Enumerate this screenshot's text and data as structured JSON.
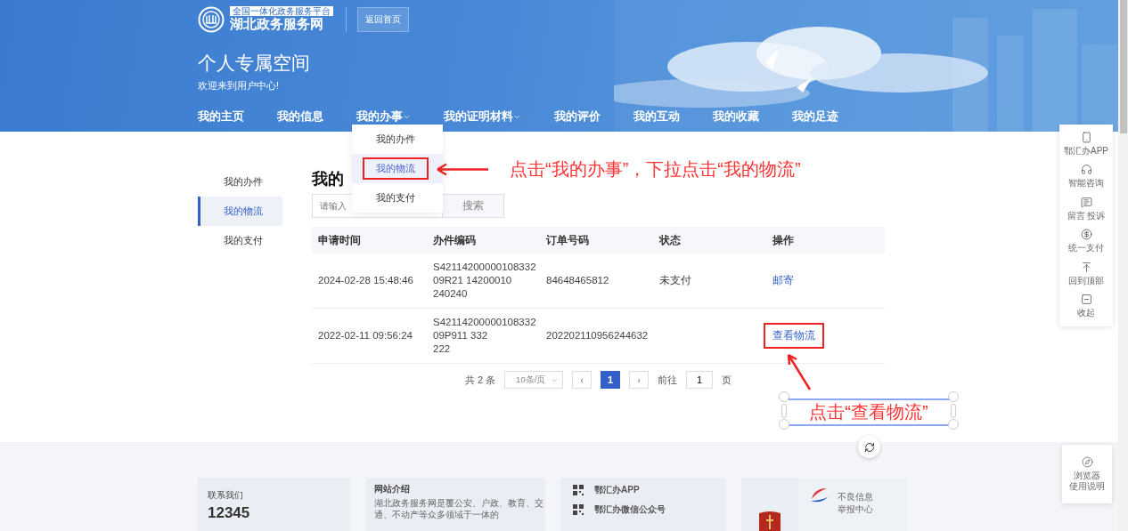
{
  "header": {
    "platform_tag": "全国一体化政务服务平台",
    "site_name": "湖北政务服务网",
    "home_button": "返回首页",
    "title": "个人专属空间",
    "welcome": "欢迎来到用户中心!"
  },
  "nav": [
    {
      "label": "我的主页",
      "dropdown": false,
      "expanded": false
    },
    {
      "label": "我的信息",
      "dropdown": false,
      "expanded": false
    },
    {
      "label": "我的办事",
      "dropdown": true,
      "expanded": true
    },
    {
      "label": "我的证明材料",
      "dropdown": true,
      "expanded": false
    },
    {
      "label": "我的评价",
      "dropdown": false,
      "expanded": false
    },
    {
      "label": "我的互动",
      "dropdown": false,
      "expanded": false
    },
    {
      "label": "我的收藏",
      "dropdown": false,
      "expanded": false
    },
    {
      "label": "我的足迹",
      "dropdown": false,
      "expanded": false
    }
  ],
  "dropdown_menu": [
    {
      "label": "我的办件",
      "selected": false
    },
    {
      "label": "我的物流",
      "selected": true
    },
    {
      "label": "我的支付",
      "selected": false
    }
  ],
  "sidebar": [
    {
      "label": "我的办件",
      "selected": false
    },
    {
      "label": "我的物流",
      "selected": true
    },
    {
      "label": "我的支付",
      "selected": false
    }
  ],
  "page_title": "我的",
  "search": {
    "placeholder": "请输入",
    "button": "搜索"
  },
  "table": {
    "columns": [
      "申请时间",
      "办件编码",
      "订单号码",
      "状态",
      "操作"
    ],
    "rows": [
      {
        "time": "2024-02-28 15:48:46",
        "code": [
          "S42114200000108332",
          "09R21 14200010",
          "240240"
        ],
        "order": "84648465812",
        "status": "未支付",
        "action": "邮寄",
        "annotated": false
      },
      {
        "time": "2022-02-11 09:56:24",
        "code": [
          "S42114200000108332",
          "09P911 332",
          "222"
        ],
        "order": "202202110956244632",
        "status": "",
        "action": "查看物流",
        "annotated": true
      }
    ]
  },
  "pagination": {
    "total": "共 2 条",
    "page_size": "10条/页",
    "prev": "‹",
    "pages": [
      {
        "label": "1",
        "selected": true
      }
    ],
    "next": "›",
    "goto_label": "前往",
    "goto_value": "1",
    "page_suffix": "页"
  },
  "annotations": {
    "menu_hint": "点击“我的办事”，下拉点击“我的物流”",
    "action_hint": "点击“查看物流”"
  },
  "side_tools": [
    {
      "label": "鄂汇办APP",
      "kind": "phone"
    },
    {
      "label": "智能咨询",
      "kind": "headset"
    },
    {
      "label": "留言 投诉",
      "kind": "chat"
    },
    {
      "label": "统一支付",
      "kind": "yen"
    },
    {
      "label": "回到顶部",
      "kind": "top"
    },
    {
      "label": "收起",
      "kind": "collapse"
    }
  ],
  "browser_help": [
    "浏览器",
    "使用说明"
  ],
  "footer": {
    "contact": {
      "label": "联系我们",
      "phone": "12345"
    },
    "intro": {
      "title": "网站介绍",
      "text": "湖北政务服务网是覆公安、户政、教育、交通、不动产等众多领域于一体的"
    },
    "apps": [
      {
        "label": "鄂汇办APP"
      },
      {
        "label": "鄂汇办微信公众号"
      }
    ],
    "report": {
      "label": "不良信息举报中心"
    }
  }
}
